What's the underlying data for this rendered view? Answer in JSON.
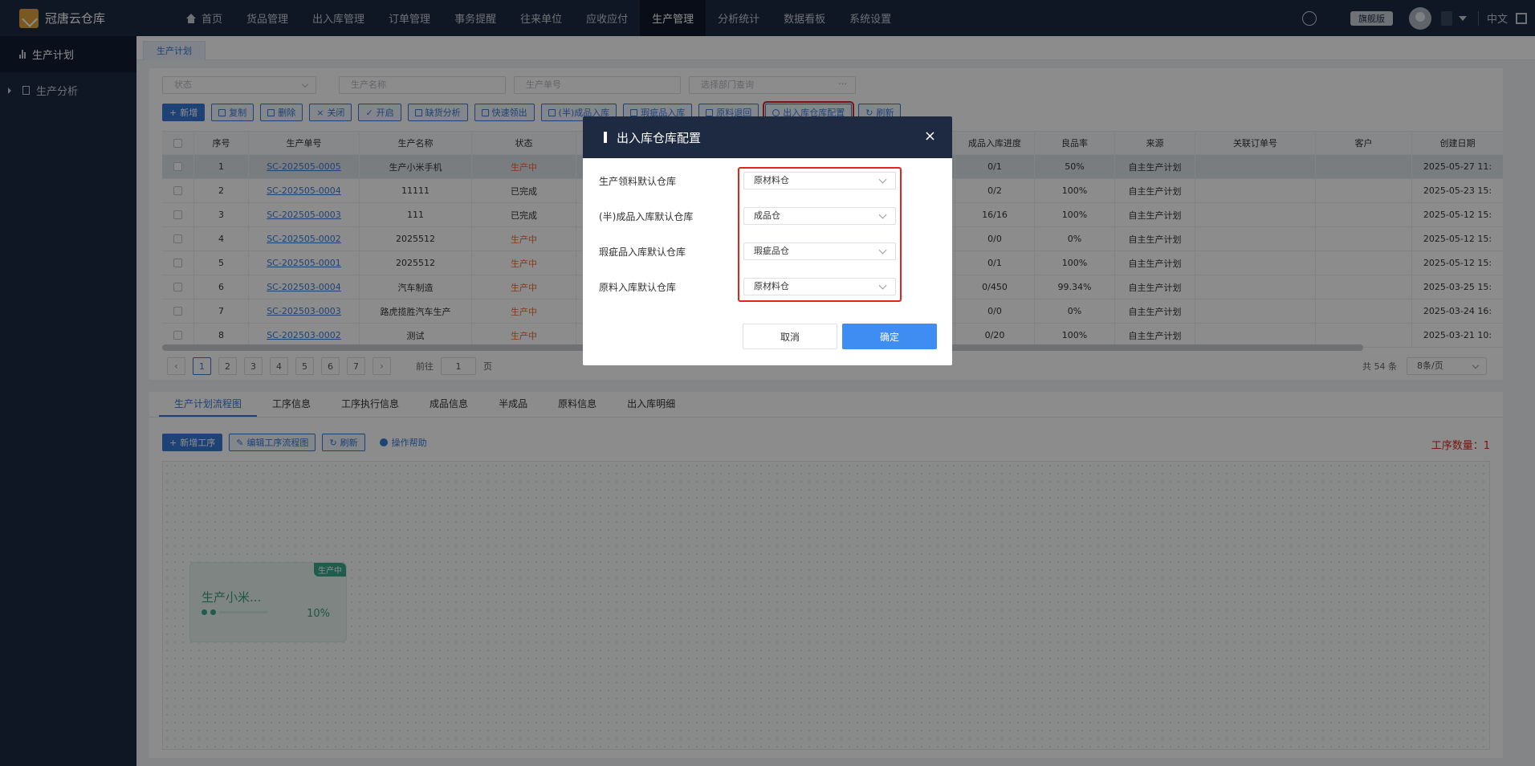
{
  "app": {
    "title": "冠唐云仓库"
  },
  "nav": [
    "首页",
    "货品管理",
    "出入库管理",
    "订单管理",
    "事务提醒",
    "往来单位",
    "应收应付",
    "生产管理",
    "分析统计",
    "数据看板",
    "系统设置"
  ],
  "topright": {
    "edition": "旗舰版",
    "lang": "中文"
  },
  "sidebar": [
    {
      "label": "生产计划"
    },
    {
      "label": "生产分析"
    }
  ],
  "tab": "生产计划",
  "filters": {
    "status": "状态",
    "name": "生产名称",
    "code": "生产单号",
    "dept": "选择部门查询"
  },
  "toolbar": [
    "新增",
    "复制",
    "删除",
    "关闭",
    "开启",
    "缺货分析",
    "快速领出",
    "(半)成品入库",
    "瑕疵品入库",
    "原料退回",
    "出入库仓库配置",
    "刷新"
  ],
  "table": {
    "headers": [
      "序号",
      "生产单号",
      "生产名称",
      "状态",
      "成品入库进度",
      "良品率",
      "来源",
      "关联订单号",
      "客户",
      "创建日期"
    ],
    "rows": [
      [
        "1",
        "SC-202505-0005",
        "生产小米手机",
        "生产中",
        "0/1",
        "50%",
        "自主生产计划",
        "",
        "",
        "2025-05-27 11:"
      ],
      [
        "2",
        "SC-202505-0004",
        "11111",
        "已完成",
        "0/2",
        "100%",
        "自主生产计划",
        "",
        "",
        "2025-05-23 15:"
      ],
      [
        "3",
        "SC-202505-0003",
        "111",
        "已完成",
        "16/16",
        "100%",
        "自主生产计划",
        "",
        "",
        "2025-05-12 15:"
      ],
      [
        "4",
        "SC-202505-0002",
        "2025512",
        "生产中",
        "0/0",
        "0%",
        "自主生产计划",
        "",
        "",
        "2025-05-12 15:"
      ],
      [
        "5",
        "SC-202505-0001",
        "2025512",
        "生产中",
        "0/1",
        "100%",
        "自主生产计划",
        "",
        "",
        "2025-05-12 15:"
      ],
      [
        "6",
        "SC-202503-0004",
        "汽车制造",
        "生产中",
        "0/450",
        "99.34%",
        "自主生产计划",
        "",
        "",
        "2025-03-25 15:"
      ],
      [
        "7",
        "SC-202503-0003",
        "路虎揽胜汽车生产",
        "生产中",
        "0/0",
        "0%",
        "自主生产计划",
        "",
        "",
        "2025-03-24 16:"
      ],
      [
        "8",
        "SC-202503-0002",
        "测试",
        "生产中",
        "0/20",
        "100%",
        "自主生产计划",
        "",
        "",
        "2025-03-21 10:"
      ]
    ]
  },
  "pager": {
    "pages": [
      "1",
      "2",
      "3",
      "4",
      "5",
      "6",
      "7"
    ],
    "goto_prefix": "前往",
    "goto_value": "1",
    "goto_suffix": "页",
    "total": "共 54 条",
    "size": "8条/页"
  },
  "lower": {
    "tabs": [
      "生产计划流程图",
      "工序信息",
      "工序执行信息",
      "成品信息",
      "半成品",
      "原料信息",
      "出入库明细"
    ],
    "buttons": [
      "新增工序",
      "编辑工序流程图",
      "刷新"
    ],
    "help": "操作帮助",
    "step_count": "工序数量：1",
    "node": {
      "badge": "生产中",
      "title": "生产小米...",
      "progress": "10%",
      "progress_fraction": 0.1
    }
  },
  "dialog": {
    "title": "出入库仓库配置",
    "fields": [
      {
        "label": "生产领料默认仓库",
        "value": "原材料仓"
      },
      {
        "label": "(半)成品入库默认仓库",
        "value": "成品仓"
      },
      {
        "label": "瑕疵品入库默认仓库",
        "value": "瑕疵品仓"
      },
      {
        "label": "原料入库默认仓库",
        "value": "原材料仓"
      }
    ],
    "cancel": "取消",
    "ok": "确定"
  },
  "colors": {
    "primary": "#3a78d8",
    "nav_bg": "#1e2a42",
    "highlight": "#e1251b",
    "in_progress": "#f56c2c"
  }
}
